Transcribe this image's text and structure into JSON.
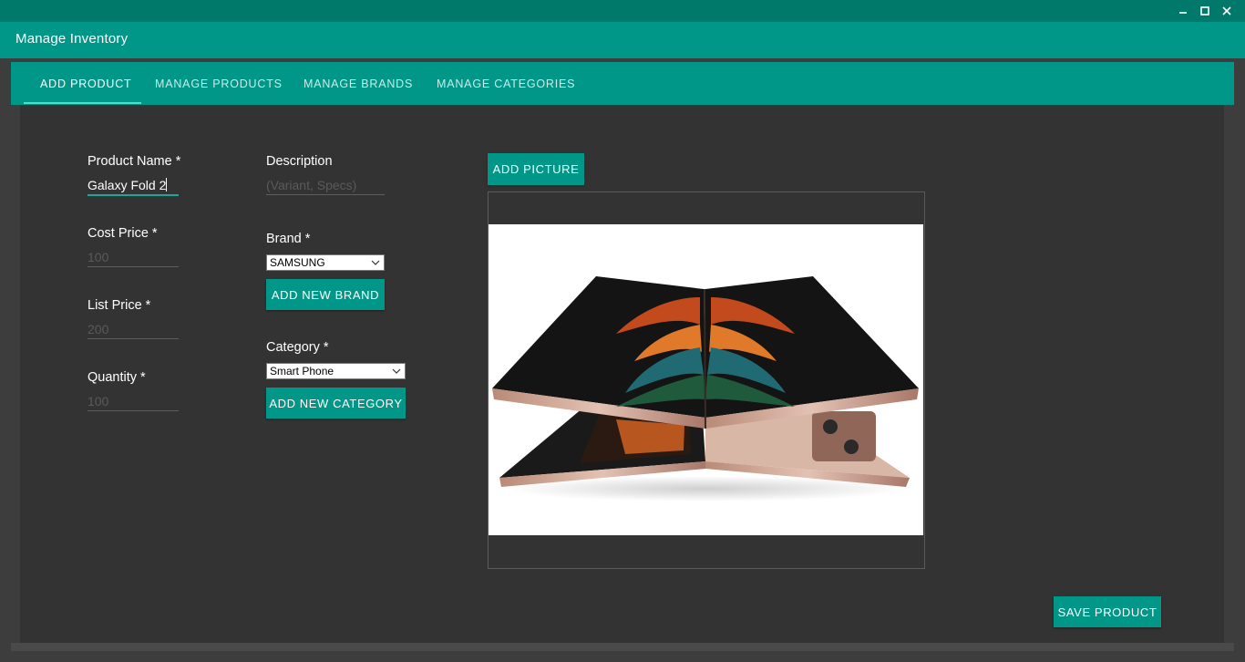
{
  "window": {
    "title": "Manage Inventory",
    "controls": [
      "minimize-icon",
      "maximize-icon",
      "close-icon"
    ]
  },
  "tabs": [
    {
      "label": "ADD PRODUCT",
      "active": true
    },
    {
      "label": "MANAGE PRODUCTS",
      "active": false
    },
    {
      "label": "MANAGE BRANDS",
      "active": false
    },
    {
      "label": "MANAGE CATEGORIES",
      "active": false
    }
  ],
  "form": {
    "product_name": {
      "label": "Product Name *",
      "value": "Galaxy Fold 2"
    },
    "cost_price": {
      "label": "Cost Price *",
      "placeholder": "100"
    },
    "list_price": {
      "label": "List Price *",
      "placeholder": "200"
    },
    "quantity": {
      "label": "Quantity *",
      "placeholder": "100"
    },
    "description": {
      "label": "Description",
      "placeholder": "(Variant, Specs)"
    },
    "brand": {
      "label": "Brand *",
      "selected": "SAMSUNG",
      "add_button": "ADD NEW BRAND"
    },
    "category": {
      "label": "Category *",
      "selected": "Smart Phone",
      "add_button": "ADD NEW CATEGORY"
    }
  },
  "picture": {
    "add_button": "ADD PICTURE",
    "image": "phone-image"
  },
  "save_button": "SAVE PRODUCT",
  "colors": {
    "accent": "#009688",
    "titlebar": "#00796b",
    "background": "#333333",
    "tab_underline": "#4ae0c9"
  }
}
